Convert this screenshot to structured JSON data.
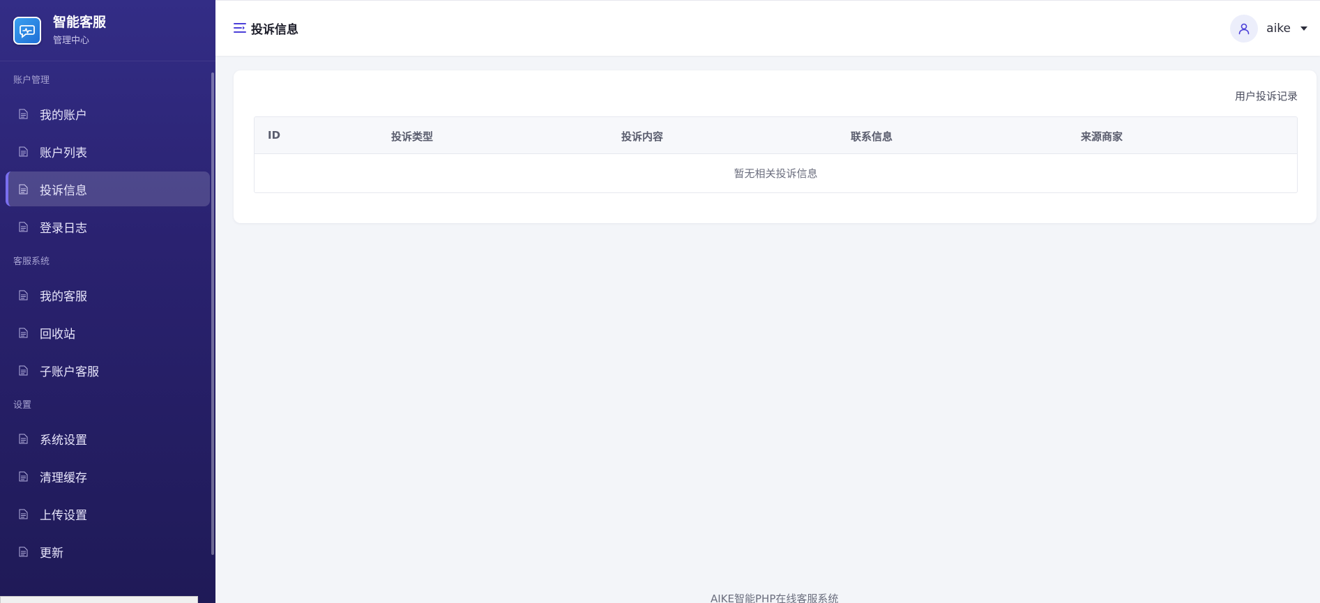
{
  "brand": {
    "title": "智能客服",
    "subtitle": "管理中心",
    "logo_icon": "chat-bubble-icon"
  },
  "sidebar": {
    "groups": [
      {
        "label": "账户管理",
        "items": [
          {
            "label": "我的账户",
            "icon": "document-icon",
            "active": false
          },
          {
            "label": "账户列表",
            "icon": "document-icon",
            "active": false
          },
          {
            "label": "投诉信息",
            "icon": "document-icon",
            "active": true
          },
          {
            "label": "登录日志",
            "icon": "document-icon",
            "active": false
          }
        ]
      },
      {
        "label": "客服系统",
        "items": [
          {
            "label": "我的客服",
            "icon": "document-icon",
            "active": false
          },
          {
            "label": "回收站",
            "icon": "document-icon",
            "active": false
          },
          {
            "label": "子账户客服",
            "icon": "document-icon",
            "active": false
          }
        ]
      },
      {
        "label": "设置",
        "items": [
          {
            "label": "系统设置",
            "icon": "document-icon",
            "active": false
          },
          {
            "label": "清理缓存",
            "icon": "document-icon",
            "active": false
          },
          {
            "label": "上传设置",
            "icon": "document-icon",
            "active": false
          },
          {
            "label": "更新",
            "icon": "document-icon",
            "active": false
          }
        ]
      }
    ]
  },
  "header": {
    "title": "投诉信息",
    "toggle_icon": "menu-toggle-icon",
    "user": {
      "name": "aike",
      "avatar_icon": "user-icon"
    }
  },
  "main": {
    "card_link": "用户投诉记录",
    "table": {
      "columns": [
        "ID",
        "投诉类型",
        "投诉内容",
        "联系信息",
        "来源商家"
      ],
      "empty_text": "暂无相关投诉信息"
    }
  },
  "footer": {
    "text": "AIKE智能PHP在线客服系统"
  },
  "colors": {
    "sidebar_top": "#332d86",
    "sidebar_bottom": "#1f1a57",
    "accent": "#5b4fe0",
    "background": "#f3f5f9"
  }
}
